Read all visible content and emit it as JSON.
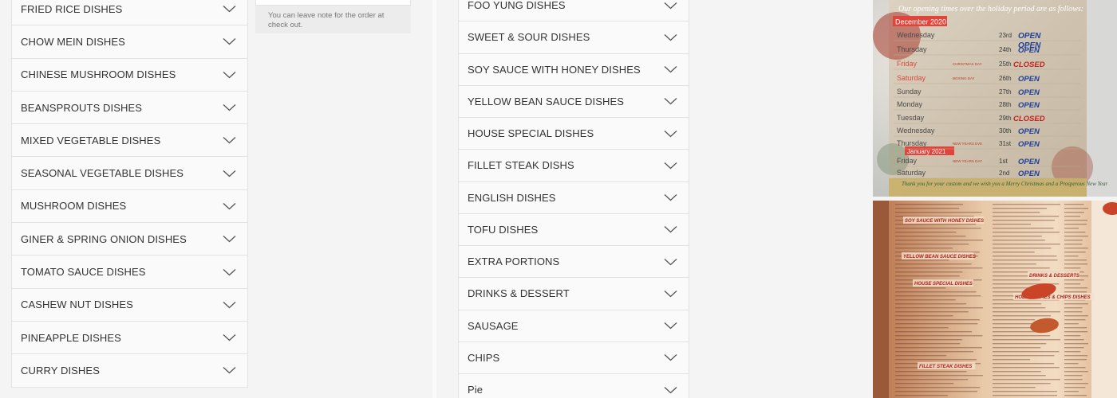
{
  "order_note": {
    "hint": "You can leave note for the order at check out."
  },
  "categories_left": [
    "FRIED RICE DISHES",
    "CHOW MEIN DISHES",
    "CHINESE MUSHROOM DISHES",
    "BEANSPROUTS DISHES",
    "MIXED VEGETABLE DISHES",
    "SEASONAL VEGETABLE DISHES",
    "MUSHROOM DISHES",
    "GINER & SPRING ONION DISHES",
    "TOMATO SAUCE DISHES",
    "CASHEW NUT DISHES",
    "PINEAPPLE DISHES",
    "CURRY DISHES"
  ],
  "categories_right": [
    "FOO YUNG DISHES",
    "SWEET & SOUR DISHES",
    "SOY SAUCE WITH HONEY DISHES",
    "YELLOW BEAN SAUCE DISHES",
    "HOUSE SPECIAL DISHES",
    "FILLET STEAK DISHS",
    "ENGLISH DISHES",
    "TOFU DISHES",
    "EXTRA PORTIONS",
    "DRINKS & DESSERT",
    "SAUSAGE",
    "CHIPS",
    "Pie"
  ],
  "opening_notice": {
    "header": "Our opening times over the holiday period are as follows:",
    "month1": "December 2020",
    "month2": "January 2021",
    "rows": [
      {
        "day": "Wednesday",
        "date": "23rd",
        "note": "",
        "status": "OPEN OPEN"
      },
      {
        "day": "Thursday",
        "date": "24th",
        "note": "",
        "status": "OPEN"
      },
      {
        "day": "Friday",
        "date": "25th",
        "note": "CHRISTMAS DAY",
        "status": "CLOSED"
      },
      {
        "day": "Saturday",
        "date": "26th",
        "note": "BOXING DAY",
        "status": "OPEN"
      },
      {
        "day": "Sunday",
        "date": "27th",
        "note": "",
        "status": "OPEN"
      },
      {
        "day": "Monday",
        "date": "28th",
        "note": "",
        "status": "OPEN"
      },
      {
        "day": "Tuesday",
        "date": "29th",
        "note": "",
        "status": "CLOSED"
      },
      {
        "day": "Wednesday",
        "date": "30th",
        "note": "",
        "status": "OPEN"
      },
      {
        "day": "Thursday",
        "date": "31st",
        "note": "NEW YEARS EVE",
        "status": "OPEN"
      },
      {
        "day": "Friday",
        "date": "1st",
        "note": "NEW YEARS DAY",
        "status": "OPEN"
      },
      {
        "day": "Saturday",
        "date": "2nd",
        "note": "",
        "status": "OPEN"
      }
    ],
    "footer": "Thank you for your custom and we wish you a Merry Christmas and a Prosperous New Year"
  },
  "menu_photo": {
    "headings": [
      "SOY SAUCE WITH HONEY DISHES",
      "YELLOW BEAN SAUCE DISHES",
      "HOUSE SPECIAL DISHES",
      "FILLET STEAK DISHES",
      "DRINKS & DESSERTS",
      "HOLLAND PIES & CHIPS DISHES"
    ]
  },
  "colors": {
    "open_status": "#1f3f9a",
    "closed_status": "#c32020",
    "december_banner": "#e0443a",
    "january_banner": "#e0443a",
    "menu_heading": "#b3201a"
  }
}
